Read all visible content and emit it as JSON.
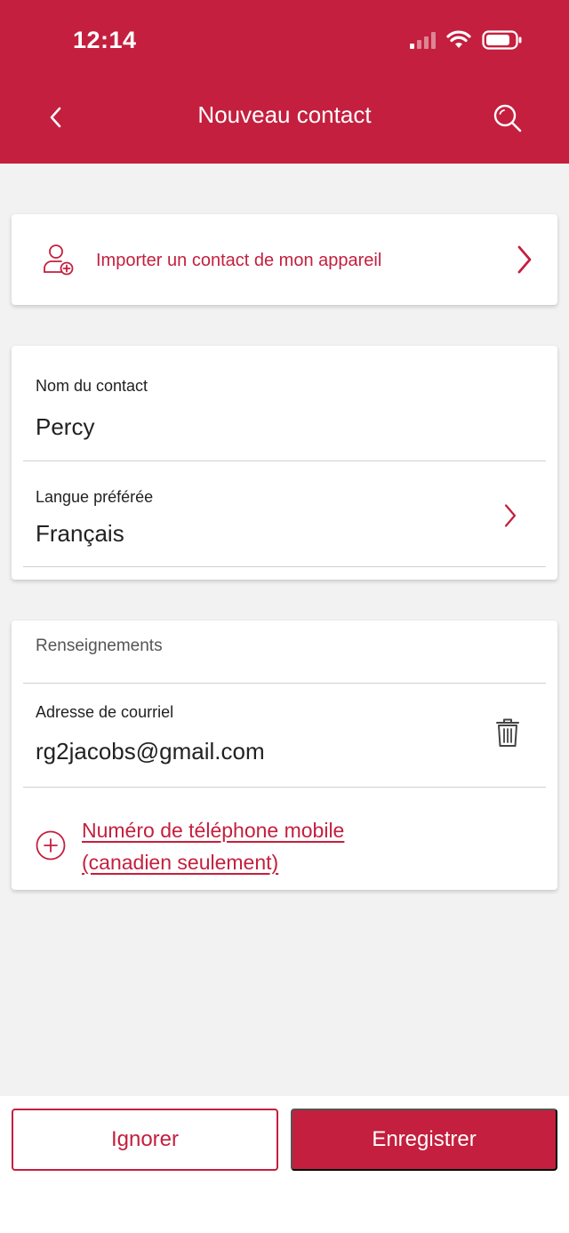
{
  "status_bar": {
    "time": "12:14",
    "icons": [
      "cellular-signal-icon",
      "wifi-icon",
      "battery-icon"
    ]
  },
  "header": {
    "title": "Nouveau contact",
    "back_icon": "chevron-left-icon",
    "search_icon": "search-icon"
  },
  "import": {
    "label": "Importer un contact de mon appareil",
    "icon": "add-person-icon"
  },
  "contact": {
    "name_label": "Nom du contact",
    "name_value": "Percy",
    "language_label": "Langue préférée",
    "language_value": "Français"
  },
  "info": {
    "section_title": "Renseignements",
    "email_label": "Adresse de courriel",
    "email_value": "rg2jacobs@gmail.com",
    "add_phone_line1": "Numéro de téléphone mobile",
    "add_phone_line2": "(canadien seulement)"
  },
  "footer": {
    "ignore_label": "Ignorer",
    "save_label": "Enregistrer"
  },
  "colors": {
    "brand": "#c41f3e",
    "background": "#f2f2f2",
    "card": "#ffffff",
    "divider": "#d0d0d0"
  }
}
